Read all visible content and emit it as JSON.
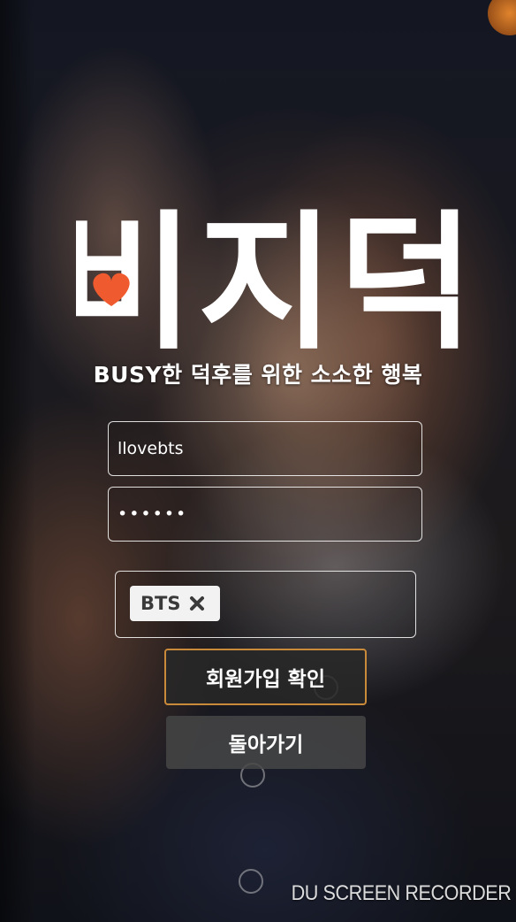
{
  "app": {
    "logo_text": "비지덕",
    "tagline": "BUSY한 덕후를 위한 소소한 행복"
  },
  "form": {
    "username_value": "llovebts",
    "password_value": "••••••",
    "tags": [
      {
        "label": "BTS",
        "remove_icon": "close-icon"
      }
    ],
    "confirm_label": "회원가입 확인",
    "back_label": "돌아가기"
  },
  "overlay": {
    "watermark": "DU SCREEN RECORDER"
  },
  "colors": {
    "heart": "#ef5a2f",
    "confirm_border": "#c98a3a",
    "text": "#ffffff"
  }
}
